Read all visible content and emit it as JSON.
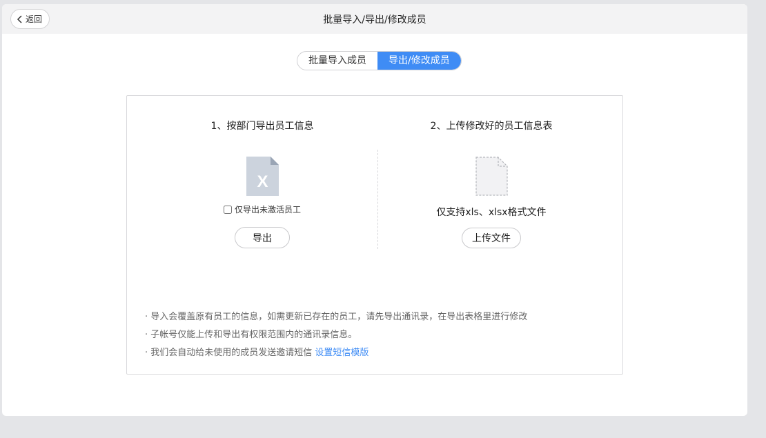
{
  "header": {
    "back_label": "返回",
    "title": "批量导入/导出/修改成员"
  },
  "tabs": [
    {
      "label": "批量导入成员",
      "active": false
    },
    {
      "label": "导出/修改成员",
      "active": true
    }
  ],
  "export_section": {
    "title": "1、按部门导出员工信息",
    "icon": "excel-file-icon",
    "icon_letter": "X",
    "checkbox_label": "仅导出未激活员工",
    "checkbox_checked": false,
    "button_label": "导出"
  },
  "upload_section": {
    "title": "2、上传修改好的员工信息表",
    "icon": "blank-file-icon",
    "support_text": "仅支持xls、xlsx格式文件",
    "button_label": "上传文件"
  },
  "notes": {
    "line1": "· 导入会覆盖原有员工的信息，如需更新已存在的员工，请先导出通讯录，在导出表格里进行修改",
    "line2": "· 子帐号仅能上传和导出有权限范围内的通讯录信息。",
    "line3": "· 我们会自动给未使用的成员发送邀请短信",
    "line3_link": "设置短信模版"
  },
  "colors": {
    "accent": "#3f8cf5",
    "background": "#e4e5e8",
    "titlebar": "#f3f3f4"
  }
}
